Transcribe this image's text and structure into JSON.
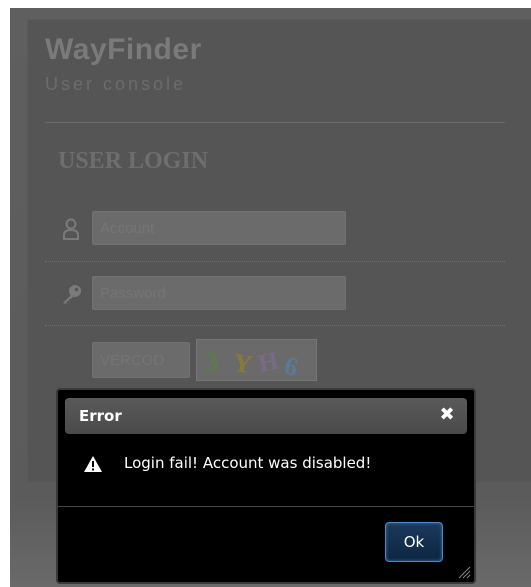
{
  "app": {
    "brand": "WayFinder",
    "subtitle": "User console"
  },
  "login": {
    "title": "USER LOGIN",
    "account_placeholder": "Account",
    "password_placeholder": "Password",
    "vercode_placeholder": "VERCOD",
    "captcha_text": "3YH6"
  },
  "dialog": {
    "title": "Error",
    "close_glyph": "✖",
    "message": "Login fail! Account was disabled!",
    "ok_label": "Ok",
    "icons": [
      "warning-icon",
      "close-icon",
      "resize-grip-icon"
    ]
  },
  "icons": [
    "user-icon",
    "key-icon"
  ]
}
